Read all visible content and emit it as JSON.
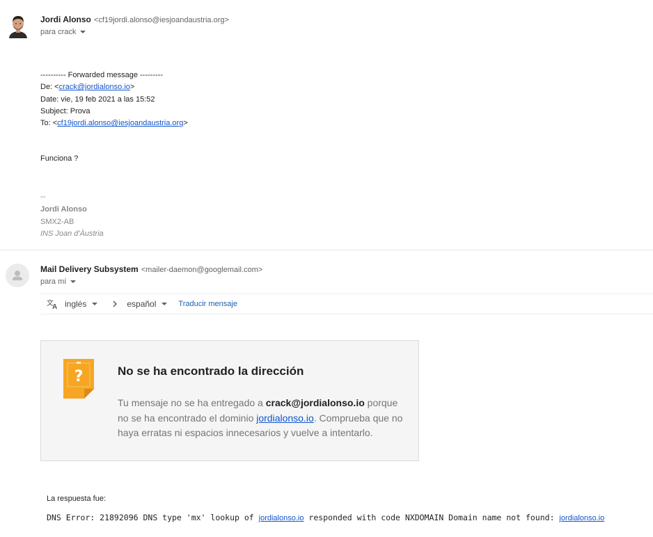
{
  "message1": {
    "sender_name": "Jordi Alonso",
    "sender_email": "<cf19jordi.alonso@iesjoandaustria.org>",
    "to_line": "para crack",
    "forward": {
      "header": "---------- Forwarded message ---------",
      "from_prefix": "De: <",
      "from_link": "crack@jordialonso.io",
      "from_suffix": ">",
      "date": "Date: vie, 19 feb 2021 a las 15:52",
      "subject": "Subject: Prova",
      "to_prefix": "To: <",
      "to_link": "cf19jordi.alonso@iesjoandaustria.org",
      "to_suffix": ">"
    },
    "body": "Funciona ?",
    "signature": {
      "dashes": "--",
      "name": "Jordi Alonso",
      "group": "SMX2-AB",
      "school": "INS Joan d'Àustria"
    }
  },
  "message2": {
    "sender_name": "Mail Delivery Subsystem",
    "sender_email": "<mailer-daemon@googlemail.com>",
    "to_line": "para mí",
    "translate": {
      "source_lang": "inglés",
      "target_lang": "español",
      "action": "Traducir mensaje"
    },
    "bounce": {
      "title": "No se ha encontrado la dirección",
      "text_1": "Tu mensaje no se ha entregado a ",
      "address": "crack@jordialonso.io",
      "text_2": " porque no se ha encontrado el dominio ",
      "domain": "jordialonso.io",
      "text_3": ". Comprueba que no haya erratas ni espacios innecesarios y vuelve a intentarlo."
    },
    "response_label": "La respuesta fue:",
    "response_part1": "DNS Error: 21892096 DNS type 'mx' lookup of ",
    "response_domain1": "jordialonso.io",
    "response_part2": " responded with code NXDOMAIN Domain name not found: ",
    "response_domain2": "jordialonso.io"
  },
  "colors": {
    "link": "#1155cc",
    "bounce_icon": "#f6a623",
    "bounce_bg": "#f5f5f5"
  },
  "icons": [
    "profile-photo",
    "default-avatar-icon",
    "translate-icon",
    "chevron-down-icon",
    "chevron-right-icon",
    "document-question-icon"
  ]
}
